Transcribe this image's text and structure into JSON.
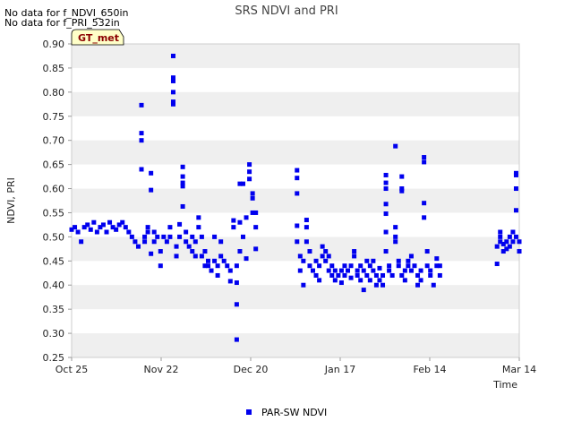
{
  "notes": [
    "No data for f_NDVI_650in",
    "No data for f_PRI_532in"
  ],
  "badge": "GT_met",
  "chart_data": {
    "type": "scatter",
    "title": "SRS NDVI and PRI",
    "xlabel": "Time",
    "ylabel": "NDVI, PRI",
    "ylim": [
      0.25,
      0.9
    ],
    "yticks": [
      "0.25",
      "0.30",
      "0.35",
      "0.40",
      "0.45",
      "0.50",
      "0.55",
      "0.60",
      "0.65",
      "0.70",
      "0.75",
      "0.80",
      "0.85",
      "0.90"
    ],
    "xlim": [
      "2023-10-25",
      "2024-03-14"
    ],
    "xticks": [
      "Oct 25",
      "Nov 22",
      "Dec 20",
      "Jan 17",
      "Feb 14",
      "Mar 14"
    ],
    "grid": "horizontal bands",
    "legend_position": "bottom-center",
    "colors": {
      "series": "#0000ee",
      "band": "#efefef",
      "badge_bg": "#ffffc8"
    },
    "series": [
      {
        "name": "PAR-SW NDVI",
        "points": [
          [
            "2023-10-25",
            0.515
          ],
          [
            "2023-10-26",
            0.52
          ],
          [
            "2023-10-27",
            0.51
          ],
          [
            "2023-10-28",
            0.49
          ],
          [
            "2023-10-29",
            0.52
          ],
          [
            "2023-10-30",
            0.525
          ],
          [
            "2023-10-31",
            0.515
          ],
          [
            "2023-11-01",
            0.53
          ],
          [
            "2023-11-02",
            0.51
          ],
          [
            "2023-11-03",
            0.52
          ],
          [
            "2023-11-04",
            0.525
          ],
          [
            "2023-11-05",
            0.51
          ],
          [
            "2023-11-06",
            0.53
          ],
          [
            "2023-11-07",
            0.52
          ],
          [
            "2023-11-08",
            0.515
          ],
          [
            "2023-11-09",
            0.525
          ],
          [
            "2023-11-10",
            0.53
          ],
          [
            "2023-11-11",
            0.52
          ],
          [
            "2023-11-12",
            0.51
          ],
          [
            "2023-11-13",
            0.5
          ],
          [
            "2023-11-14",
            0.49
          ],
          [
            "2023-11-15",
            0.48
          ],
          [
            "2023-11-16",
            0.64
          ],
          [
            "2023-11-16",
            0.7
          ],
          [
            "2023-11-16",
            0.715
          ],
          [
            "2023-11-16",
            0.773
          ],
          [
            "2023-11-17",
            0.5
          ],
          [
            "2023-11-17",
            0.49
          ],
          [
            "2023-11-18",
            0.51
          ],
          [
            "2023-11-18",
            0.52
          ],
          [
            "2023-11-19",
            0.597
          ],
          [
            "2023-11-19",
            0.632
          ],
          [
            "2023-11-19",
            0.465
          ],
          [
            "2023-11-20",
            0.49
          ],
          [
            "2023-11-20",
            0.51
          ],
          [
            "2023-11-21",
            0.5
          ],
          [
            "2023-11-22",
            0.44
          ],
          [
            "2023-11-22",
            0.47
          ],
          [
            "2023-11-23",
            0.5
          ],
          [
            "2023-11-24",
            0.49
          ],
          [
            "2023-11-25",
            0.52
          ],
          [
            "2023-11-25",
            0.5
          ],
          [
            "2023-11-26",
            0.775
          ],
          [
            "2023-11-26",
            0.78
          ],
          [
            "2023-11-26",
            0.8
          ],
          [
            "2023-11-26",
            0.823
          ],
          [
            "2023-11-26",
            0.83
          ],
          [
            "2023-11-26",
            0.875
          ],
          [
            "2023-11-27",
            0.48
          ],
          [
            "2023-11-27",
            0.46
          ],
          [
            "2023-11-28",
            0.5
          ],
          [
            "2023-11-28",
            0.526
          ],
          [
            "2023-11-29",
            0.563
          ],
          [
            "2023-11-29",
            0.605
          ],
          [
            "2023-11-29",
            0.612
          ],
          [
            "2023-11-29",
            0.625
          ],
          [
            "2023-11-29",
            0.645
          ],
          [
            "2023-11-30",
            0.49
          ],
          [
            "2023-11-30",
            0.51
          ],
          [
            "2023-12-01",
            0.48
          ],
          [
            "2023-12-02",
            0.5
          ],
          [
            "2023-12-02",
            0.47
          ],
          [
            "2023-12-03",
            0.49
          ],
          [
            "2023-12-03",
            0.46
          ],
          [
            "2023-12-04",
            0.54
          ],
          [
            "2023-12-04",
            0.52
          ],
          [
            "2023-12-05",
            0.5
          ],
          [
            "2023-12-05",
            0.46
          ],
          [
            "2023-12-06",
            0.44
          ],
          [
            "2023-12-06",
            0.47
          ],
          [
            "2023-12-07",
            0.45
          ],
          [
            "2023-12-07",
            0.44
          ],
          [
            "2023-12-08",
            0.43
          ],
          [
            "2023-12-09",
            0.45
          ],
          [
            "2023-12-09",
            0.5
          ],
          [
            "2023-12-10",
            0.44
          ],
          [
            "2023-12-10",
            0.42
          ],
          [
            "2023-12-11",
            0.46
          ],
          [
            "2023-12-11",
            0.49
          ],
          [
            "2023-12-12",
            0.45
          ],
          [
            "2023-12-13",
            0.44
          ],
          [
            "2023-12-14",
            0.408
          ],
          [
            "2023-12-14",
            0.43
          ],
          [
            "2023-12-15",
            0.52
          ],
          [
            "2023-12-15",
            0.534
          ],
          [
            "2023-12-16",
            0.405
          ],
          [
            "2023-12-16",
            0.36
          ],
          [
            "2023-12-16",
            0.287
          ],
          [
            "2023-12-16",
            0.44
          ],
          [
            "2023-12-17",
            0.47
          ],
          [
            "2023-12-17",
            0.61
          ],
          [
            "2023-12-17",
            0.53
          ],
          [
            "2023-12-18",
            0.5
          ],
          [
            "2023-12-18",
            0.61
          ],
          [
            "2023-12-19",
            0.455
          ],
          [
            "2023-12-19",
            0.54
          ],
          [
            "2023-12-20",
            0.62
          ],
          [
            "2023-12-20",
            0.635
          ],
          [
            "2023-12-20",
            0.65
          ],
          [
            "2023-12-21",
            0.58
          ],
          [
            "2023-12-21",
            0.59
          ],
          [
            "2023-12-21",
            0.55
          ],
          [
            "2023-12-22",
            0.52
          ],
          [
            "2023-12-22",
            0.475
          ],
          [
            "2023-12-22",
            0.55
          ],
          [
            "2024-01-04",
            0.49
          ],
          [
            "2024-01-04",
            0.523
          ],
          [
            "2024-01-04",
            0.59
          ],
          [
            "2024-01-04",
            0.622
          ],
          [
            "2024-01-04",
            0.638
          ],
          [
            "2024-01-05",
            0.46
          ],
          [
            "2024-01-05",
            0.43
          ],
          [
            "2024-01-06",
            0.4
          ],
          [
            "2024-01-06",
            0.45
          ],
          [
            "2024-01-07",
            0.52
          ],
          [
            "2024-01-07",
            0.535
          ],
          [
            "2024-01-07",
            0.49
          ],
          [
            "2024-01-08",
            0.44
          ],
          [
            "2024-01-08",
            0.47
          ],
          [
            "2024-01-09",
            0.43
          ],
          [
            "2024-01-10",
            0.45
          ],
          [
            "2024-01-10",
            0.42
          ],
          [
            "2024-01-11",
            0.44
          ],
          [
            "2024-01-11",
            0.41
          ],
          [
            "2024-01-12",
            0.46
          ],
          [
            "2024-01-12",
            0.48
          ],
          [
            "2024-01-13",
            0.47
          ],
          [
            "2024-01-13",
            0.45
          ],
          [
            "2024-01-14",
            0.43
          ],
          [
            "2024-01-14",
            0.46
          ],
          [
            "2024-01-15",
            0.42
          ],
          [
            "2024-01-15",
            0.44
          ],
          [
            "2024-01-16",
            0.43
          ],
          [
            "2024-01-16",
            0.41
          ],
          [
            "2024-01-17",
            0.42
          ],
          [
            "2024-01-18",
            0.43
          ],
          [
            "2024-01-18",
            0.405
          ],
          [
            "2024-01-19",
            0.44
          ],
          [
            "2024-01-19",
            0.42
          ],
          [
            "2024-01-20",
            0.43
          ],
          [
            "2024-01-21",
            0.415
          ],
          [
            "2024-01-21",
            0.44
          ],
          [
            "2024-01-22",
            0.47
          ],
          [
            "2024-01-22",
            0.46
          ],
          [
            "2024-01-23",
            0.43
          ],
          [
            "2024-01-23",
            0.42
          ],
          [
            "2024-01-24",
            0.44
          ],
          [
            "2024-01-24",
            0.41
          ],
          [
            "2024-01-25",
            0.43
          ],
          [
            "2024-01-25",
            0.39
          ],
          [
            "2024-01-26",
            0.45
          ],
          [
            "2024-01-26",
            0.42
          ],
          [
            "2024-01-27",
            0.44
          ],
          [
            "2024-01-27",
            0.41
          ],
          [
            "2024-01-28",
            0.45
          ],
          [
            "2024-01-28",
            0.43
          ],
          [
            "2024-01-29",
            0.42
          ],
          [
            "2024-01-29",
            0.4
          ],
          [
            "2024-01-30",
            0.435
          ],
          [
            "2024-01-30",
            0.41
          ],
          [
            "2024-01-31",
            0.42
          ],
          [
            "2024-01-31",
            0.4
          ],
          [
            "2024-02-01",
            0.548
          ],
          [
            "2024-02-01",
            0.568
          ],
          [
            "2024-02-01",
            0.6
          ],
          [
            "2024-02-01",
            0.612
          ],
          [
            "2024-02-01",
            0.628
          ],
          [
            "2024-02-01",
            0.51
          ],
          [
            "2024-02-01",
            0.47
          ],
          [
            "2024-02-02",
            0.43
          ],
          [
            "2024-02-02",
            0.44
          ],
          [
            "2024-02-03",
            0.42
          ],
          [
            "2024-02-04",
            0.688
          ],
          [
            "2024-02-04",
            0.52
          ],
          [
            "2024-02-04",
            0.49
          ],
          [
            "2024-02-04",
            0.5
          ],
          [
            "2024-02-05",
            0.44
          ],
          [
            "2024-02-05",
            0.45
          ],
          [
            "2024-02-06",
            0.595
          ],
          [
            "2024-02-06",
            0.6
          ],
          [
            "2024-02-06",
            0.625
          ],
          [
            "2024-02-06",
            0.42
          ],
          [
            "2024-02-07",
            0.43
          ],
          [
            "2024-02-07",
            0.41
          ],
          [
            "2024-02-08",
            0.45
          ],
          [
            "2024-02-08",
            0.44
          ],
          [
            "2024-02-09",
            0.46
          ],
          [
            "2024-02-09",
            0.43
          ],
          [
            "2024-02-10",
            0.44
          ],
          [
            "2024-02-11",
            0.42
          ],
          [
            "2024-02-11",
            0.4
          ],
          [
            "2024-02-12",
            0.41
          ],
          [
            "2024-02-12",
            0.43
          ],
          [
            "2024-02-13",
            0.54
          ],
          [
            "2024-02-13",
            0.57
          ],
          [
            "2024-02-13",
            0.655
          ],
          [
            "2024-02-13",
            0.665
          ],
          [
            "2024-02-14",
            0.47
          ],
          [
            "2024-02-14",
            0.44
          ],
          [
            "2024-02-15",
            0.42
          ],
          [
            "2024-02-15",
            0.43
          ],
          [
            "2024-02-16",
            0.4
          ],
          [
            "2024-02-17",
            0.44
          ],
          [
            "2024-02-17",
            0.455
          ],
          [
            "2024-02-18",
            0.42
          ],
          [
            "2024-02-18",
            0.44
          ],
          [
            "2024-03-07",
            0.444
          ],
          [
            "2024-03-07",
            0.48
          ],
          [
            "2024-03-08",
            0.49
          ],
          [
            "2024-03-08",
            0.5
          ],
          [
            "2024-03-08",
            0.51
          ],
          [
            "2024-03-09",
            0.47
          ],
          [
            "2024-03-09",
            0.485
          ],
          [
            "2024-03-10",
            0.475
          ],
          [
            "2024-03-10",
            0.49
          ],
          [
            "2024-03-11",
            0.48
          ],
          [
            "2024-03-11",
            0.5
          ],
          [
            "2024-03-12",
            0.49
          ],
          [
            "2024-03-12",
            0.51
          ],
          [
            "2024-03-13",
            0.555
          ],
          [
            "2024-03-13",
            0.6
          ],
          [
            "2024-03-13",
            0.628
          ],
          [
            "2024-03-13",
            0.632
          ],
          [
            "2024-03-13",
            0.5
          ],
          [
            "2024-03-14",
            0.47
          ],
          [
            "2024-03-14",
            0.49
          ]
        ]
      }
    ]
  }
}
